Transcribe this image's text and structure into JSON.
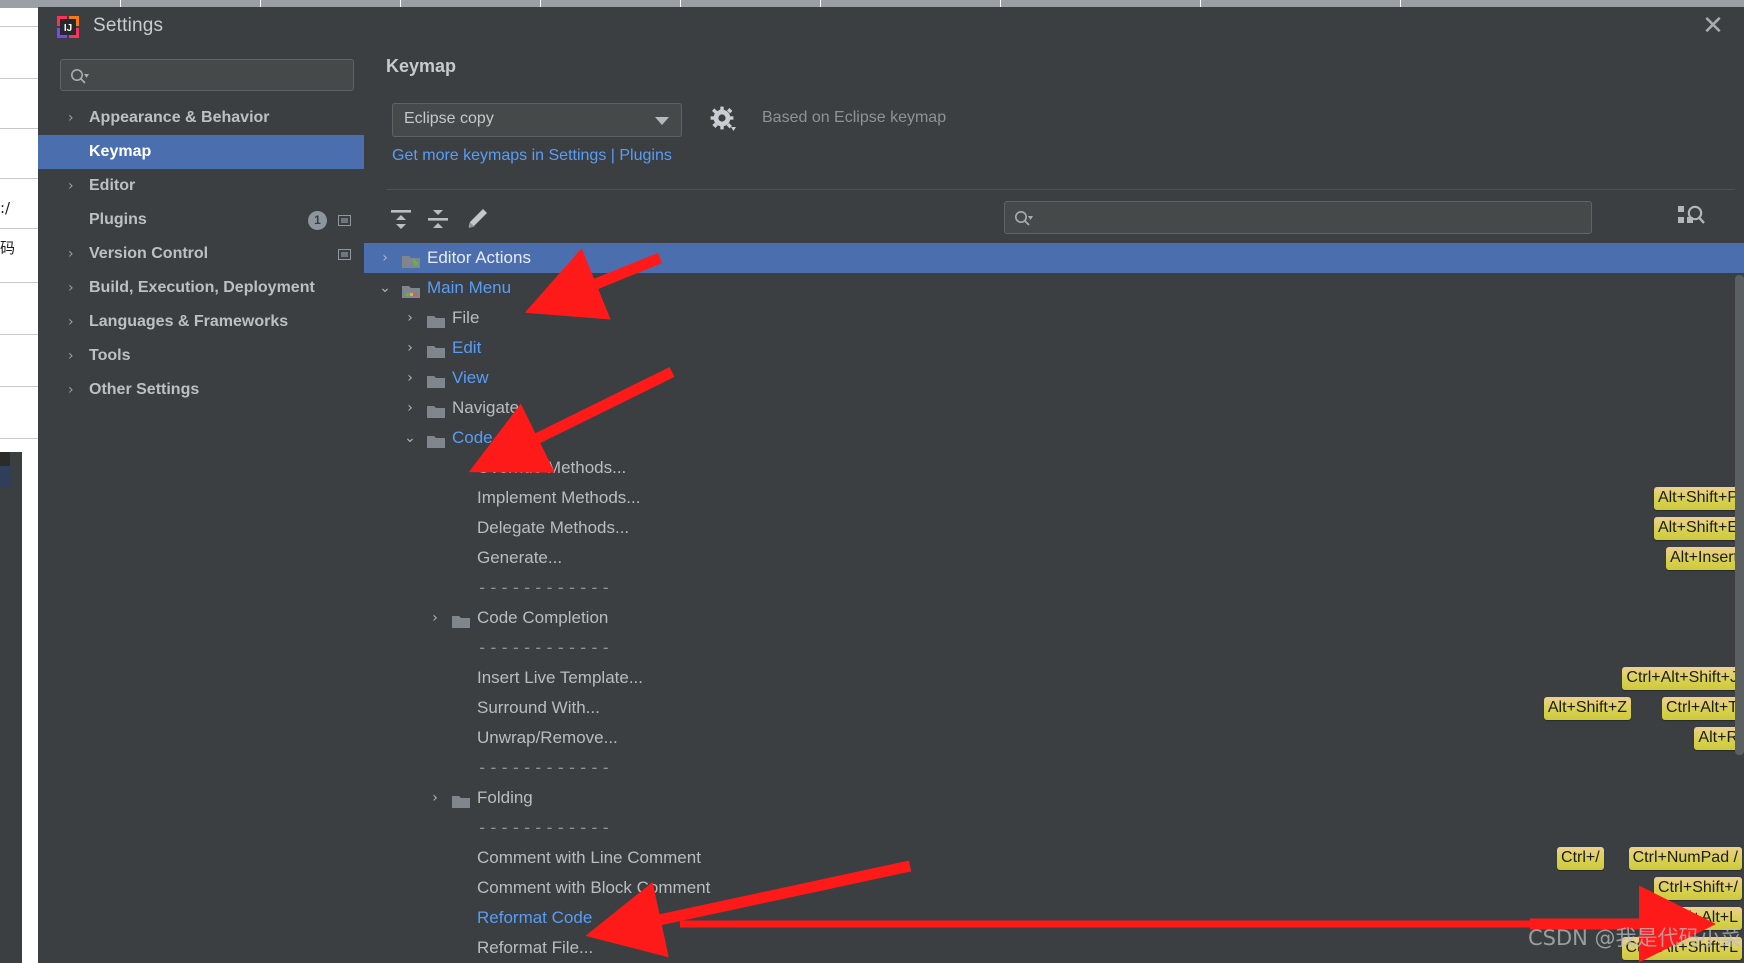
{
  "window": {
    "title": "Settings",
    "close_label": "✕",
    "logo_name": "intellij-idea-logo"
  },
  "left_panel": {
    "search": {
      "placeholder": "",
      "value": "",
      "icon": "search-icon"
    },
    "items": [
      {
        "label": "Appearance & Behavior",
        "arrow": "›",
        "expandable": true,
        "selected": false
      },
      {
        "label": "Keymap",
        "arrow": "",
        "expandable": false,
        "selected": true
      },
      {
        "label": "Editor",
        "arrow": "›",
        "expandable": true,
        "selected": false
      },
      {
        "label": "Plugins",
        "arrow": "",
        "expandable": false,
        "selected": false,
        "badge": "1",
        "square": true
      },
      {
        "label": "Version Control",
        "arrow": "›",
        "expandable": true,
        "selected": false,
        "square": true
      },
      {
        "label": "Build, Execution, Deployment",
        "arrow": "›",
        "expandable": true,
        "selected": false
      },
      {
        "label": "Languages & Frameworks",
        "arrow": "›",
        "expandable": true,
        "selected": false
      },
      {
        "label": "Tools",
        "arrow": "›",
        "expandable": true,
        "selected": false
      },
      {
        "label": "Other Settings",
        "arrow": "›",
        "expandable": true,
        "selected": false
      }
    ]
  },
  "main": {
    "page_title": "Keymap",
    "keymap_select": {
      "value": "Eclipse copy"
    },
    "gear_label": "gear-icon",
    "based_on": "Based on Eclipse keymap",
    "plugins_link": "Get more keymaps in Settings | Plugins",
    "toolbar": {
      "expand_all": "expand-all-icon",
      "collapse_all": "collapse-all-icon",
      "edit": "edit-pencil-icon",
      "find_by_shortcut": "find-by-shortcut-icon",
      "search": {
        "placeholder": "",
        "value": ""
      }
    }
  },
  "tree": {
    "rows": [
      {
        "type": "node",
        "label": "Editor Actions",
        "indent": 0,
        "arrow": "›",
        "icon": "editor-actions-icon",
        "selected": true,
        "modified": false
      },
      {
        "type": "node",
        "label": "Main Menu",
        "indent": 0,
        "arrow": "⌄",
        "icon": "main-menu-icon",
        "selected": false,
        "modified": true
      },
      {
        "type": "node",
        "label": "File",
        "indent": 1,
        "arrow": "›",
        "icon": "folder-icon",
        "selected": false,
        "modified": false
      },
      {
        "type": "node",
        "label": "Edit",
        "indent": 1,
        "arrow": "›",
        "icon": "folder-icon",
        "selected": false,
        "modified": true
      },
      {
        "type": "node",
        "label": "View",
        "indent": 1,
        "arrow": "›",
        "icon": "folder-icon",
        "selected": false,
        "modified": true
      },
      {
        "type": "node",
        "label": "Navigate",
        "indent": 1,
        "arrow": "›",
        "icon": "folder-icon",
        "selected": false,
        "modified": false
      },
      {
        "type": "node",
        "label": "Code",
        "indent": 1,
        "arrow": "⌄",
        "icon": "folder-icon",
        "selected": false,
        "modified": true
      },
      {
        "type": "leaf",
        "label": "Override Methods...",
        "indent": 2,
        "modified": false,
        "shortcuts": []
      },
      {
        "type": "leaf",
        "label": "Implement Methods...",
        "indent": 2,
        "modified": false,
        "shortcuts": [
          "Alt+Shift+P"
        ]
      },
      {
        "type": "leaf",
        "label": "Delegate Methods...",
        "indent": 2,
        "modified": false,
        "shortcuts": [
          "Alt+Shift+E"
        ]
      },
      {
        "type": "leaf",
        "label": "Generate...",
        "indent": 2,
        "modified": false,
        "shortcuts": [
          "Alt+Insert"
        ]
      },
      {
        "type": "separator",
        "label": "------------",
        "indent": 2
      },
      {
        "type": "node",
        "label": "Code Completion",
        "indent": 2,
        "arrow": "›",
        "icon": "folder-icon",
        "selected": false,
        "modified": false
      },
      {
        "type": "separator",
        "label": "------------",
        "indent": 2
      },
      {
        "type": "leaf",
        "label": "Insert Live Template...",
        "indent": 2,
        "modified": false,
        "shortcuts": [
          "Ctrl+Alt+Shift+J"
        ]
      },
      {
        "type": "leaf",
        "label": "Surround With...",
        "indent": 2,
        "modified": false,
        "shortcuts": [
          "Alt+Shift+Z",
          "Ctrl+Alt+T"
        ]
      },
      {
        "type": "leaf",
        "label": "Unwrap/Remove...",
        "indent": 2,
        "modified": false,
        "shortcuts": [
          "Alt+R"
        ]
      },
      {
        "type": "separator",
        "label": "------------",
        "indent": 2
      },
      {
        "type": "node",
        "label": "Folding",
        "indent": 2,
        "arrow": "›",
        "icon": "folder-icon",
        "selected": false,
        "modified": false
      },
      {
        "type": "separator",
        "label": "------------",
        "indent": 2
      },
      {
        "type": "leaf",
        "label": "Comment with Line Comment",
        "indent": 2,
        "modified": false,
        "shortcuts": [
          "Ctrl+/",
          "Ctrl+NumPad /"
        ]
      },
      {
        "type": "leaf",
        "label": "Comment with Block Comment",
        "indent": 2,
        "modified": false,
        "shortcuts": [
          "Ctrl+Shift+/"
        ]
      },
      {
        "type": "leaf",
        "label": "Reformat Code",
        "indent": 2,
        "modified": true,
        "shortcuts": [
          "Ctrl+Alt+L"
        ]
      },
      {
        "type": "leaf",
        "label": "Reformat File...",
        "indent": 2,
        "modified": false,
        "shortcuts": [
          "Ctrl+Alt+Shift+L"
        ]
      }
    ]
  },
  "annotations": {
    "color": "#ff1a1a",
    "arrows": [
      {
        "name": "arrow-to-main-menu"
      },
      {
        "name": "arrow-to-code"
      },
      {
        "name": "arrow-to-reformat-code"
      }
    ]
  },
  "watermark": {
    "text": "CSDN @我是代码小菜"
  },
  "colors": {
    "window_bg": "#3c3f41",
    "selection_blue": "#4b6eaf",
    "link_blue": "#589df6",
    "shortcut_yellow": "#d8d150",
    "annotation_red": "#ff1a1a"
  }
}
